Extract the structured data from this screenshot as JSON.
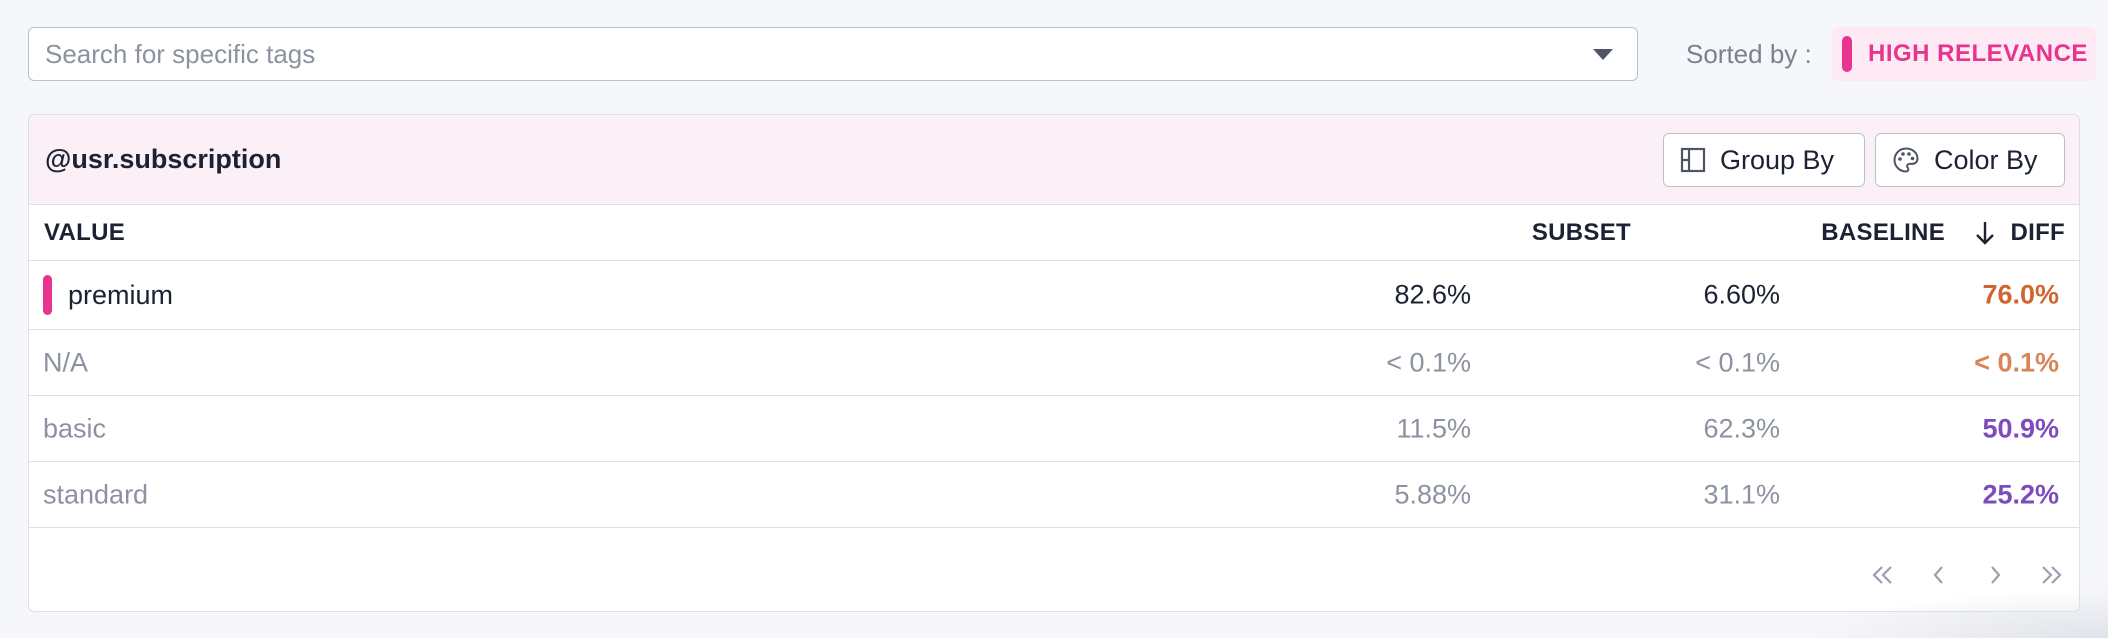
{
  "search": {
    "placeholder": "Search for specific tags",
    "value": ""
  },
  "sort": {
    "label": "Sorted by :",
    "value": "HIGH RELEVANCE",
    "accent": "#e8348f"
  },
  "facet": {
    "title": "@usr.subscription",
    "buttons": {
      "group_by": "Group By",
      "color_by": "Color By"
    }
  },
  "table": {
    "columns": {
      "value": "VALUE",
      "subset": "SUBSET",
      "baseline": "BASELINE",
      "diff": "DIFF"
    },
    "sort_column": "DIFF",
    "rows": [
      {
        "value": "premium",
        "subset": "82.6%",
        "subset_fraction": 0.826,
        "baseline": "6.60%",
        "baseline_fraction": 0.066,
        "diff": "76.0%",
        "diff_color": "orange",
        "highlighted": true
      },
      {
        "value": "N/A",
        "subset": "< 0.1%",
        "subset_fraction": 0.0,
        "baseline": "< 0.1%",
        "baseline_fraction": 0.0,
        "diff": "< 0.1%",
        "diff_color": "orange",
        "highlighted": false
      },
      {
        "value": "basic",
        "subset": "11.5%",
        "subset_fraction": 0.115,
        "baseline": "62.3%",
        "baseline_fraction": 0.623,
        "diff": "50.9%",
        "diff_color": "purple",
        "highlighted": false
      },
      {
        "value": "standard",
        "subset": "5.88%",
        "subset_fraction": 0.0588,
        "baseline": "31.1%",
        "baseline_fraction": 0.311,
        "diff": "25.2%",
        "diff_color": "purple",
        "highlighted": false
      }
    ]
  },
  "pagination": {
    "icons": [
      "first-page-icon",
      "prev-page-icon",
      "next-page-icon",
      "last-page-icon"
    ]
  },
  "colors": {
    "subset_bar": "#d0652f",
    "baseline_bar": "#5c33a6",
    "track": "#e2e4ea",
    "header_bg": "#fcf0f7"
  }
}
